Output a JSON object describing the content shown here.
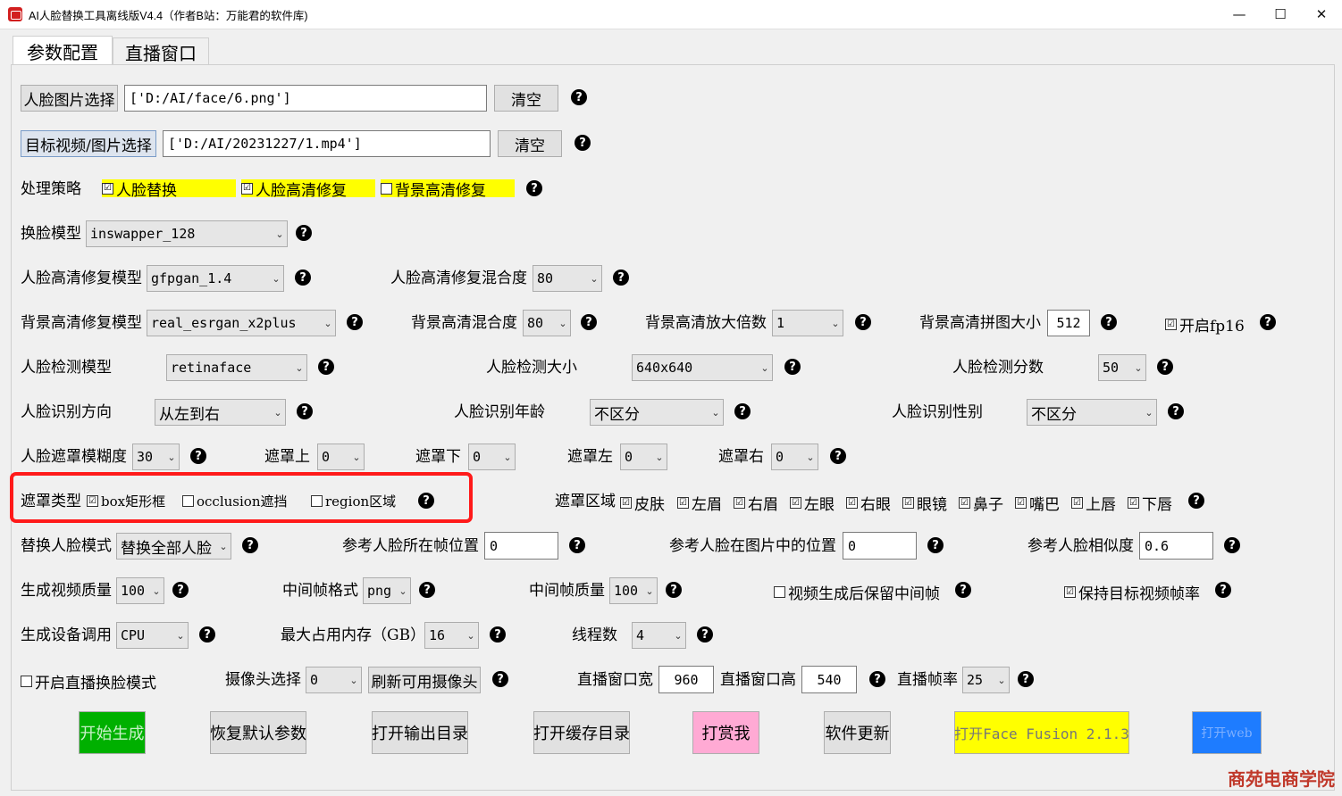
{
  "window": {
    "title": "AI人脸替换工具离线版V4.4（作者B站：万能君的软件库)",
    "minimize": "—",
    "maximize": "☐",
    "close": "✕"
  },
  "tabs": [
    {
      "label": "参数配置"
    },
    {
      "label": "直播窗口"
    }
  ],
  "face_select": {
    "button": "人脸图片选择",
    "value": "['D:/AI/face/6.png']",
    "clear": "清空"
  },
  "target_select": {
    "button": "目标视频/图片选择",
    "value": "['D:/AI/20231227/1.mp4']",
    "clear": "清空"
  },
  "strategy": {
    "label": "处理策略",
    "opt1": "人脸替换",
    "opt2": "人脸高清修复",
    "opt3": "背景高清修复",
    "check_on": "☑",
    "check_off": "☐"
  },
  "swap_model": {
    "label": "换脸模型",
    "value": "inswapper_128"
  },
  "face_enhance": {
    "label": "人脸高清修复模型",
    "value": "gfpgan_1.4",
    "blend_label": "人脸高清修复混合度",
    "blend": "80"
  },
  "bg_enhance": {
    "label": "背景高清修复模型",
    "value": "real_esrgan_x2plus",
    "blend_label": "背景高清混合度",
    "blend": "80",
    "scale_label": "背景高清放大倍数",
    "scale": "1",
    "tile_label": "背景高清拼图大小",
    "tile": "512",
    "fp16": "开启fp16"
  },
  "detect": {
    "model_label": "人脸检测模型",
    "model": "retinaface",
    "size_label": "人脸检测大小",
    "size": "640x640",
    "score_label": "人脸检测分数",
    "score": "50"
  },
  "recog": {
    "dir_label": "人脸识别方向",
    "dir": "从左到右",
    "age_label": "人脸识别年龄",
    "age": "不区分",
    "gender_label": "人脸识别性别",
    "gender": "不区分"
  },
  "mask": {
    "blur_label": "人脸遮罩模糊度",
    "blur": "30",
    "top_label": "遮罩上",
    "top": "0",
    "bottom_label": "遮罩下",
    "bottom": "0",
    "left_label": "遮罩左",
    "left": "0",
    "right_label": "遮罩右",
    "right": "0"
  },
  "mask_type": {
    "label": "遮罩类型",
    "box": "box矩形框",
    "occlusion": "occlusion遮挡",
    "region": "region区域"
  },
  "mask_region": {
    "label": "遮罩区域",
    "items": [
      "皮肤",
      "左眉",
      "右眉",
      "左眼",
      "右眼",
      "眼镜",
      "鼻子",
      "嘴巴",
      "上唇",
      "下唇"
    ]
  },
  "replace": {
    "mode_label": "替换人脸模式",
    "mode": "替换全部人脸",
    "frame_label": "参考人脸所在帧位置",
    "frame": "0",
    "pos_label": "参考人脸在图片中的位置",
    "pos": "0",
    "sim_label": "参考人脸相似度",
    "sim": "0.6"
  },
  "output": {
    "quality_label": "生成视频质量",
    "quality": "100",
    "fmt_label": "中间帧格式",
    "fmt": "png",
    "fq_label": "中间帧质量",
    "fq": "100",
    "keep_label": "视频生成后保留中间帧",
    "fps_label": "保持目标视频帧率"
  },
  "device": {
    "label": "生成设备调用",
    "value": "CPU",
    "mem_label": "最大占用内存（GB）",
    "mem": "16",
    "threads_label": "线程数",
    "threads": "4"
  },
  "live": {
    "mode_label": "开启直播换脸模式",
    "cam_label": "摄像头选择",
    "cam": "0",
    "refresh": "刷新可用摄像头",
    "w_label": "直播窗口宽",
    "w": "960",
    "h_label": "直播窗口高",
    "h": "540",
    "fps_label": "直播帧率",
    "fps": "25"
  },
  "actions": {
    "start": "开始生成",
    "reset": "恢复默认参数",
    "open_out": "打开输出目录",
    "open_cache": "打开缓存目录",
    "tip": "打赏我",
    "update": "软件更新",
    "ff": "打开Face Fusion 2.1.3",
    "blue": "打开web"
  },
  "watermark": "商苑电商学院",
  "colors": {
    "start": "#00b000",
    "tip": "#ffaad4",
    "ff": "#ffff00",
    "blue": "#1e7cff",
    "highlight": "#ffff00",
    "frame": "#ff1a1a"
  }
}
